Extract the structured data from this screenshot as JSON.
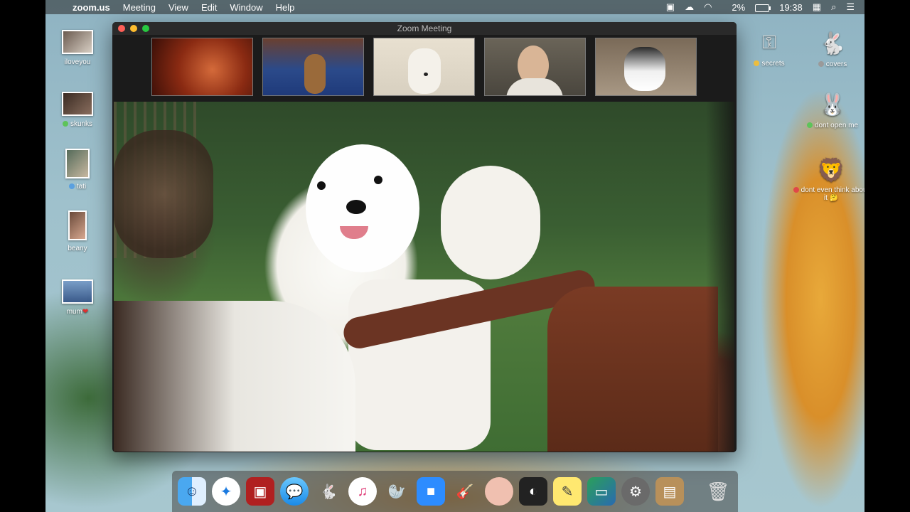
{
  "menubar": {
    "app": "zoom.us",
    "items": [
      "Meeting",
      "View",
      "Edit",
      "Window",
      "Help"
    ],
    "battery": "2%",
    "time": "19:38"
  },
  "window": {
    "title": "Zoom Meeting"
  },
  "desktop_left": [
    {
      "label": "iloveyou",
      "dot_color": ""
    },
    {
      "label": "skunks",
      "dot_color": "#5ec35a"
    },
    {
      "label": "tati",
      "dot_color": "#5aa0e0"
    },
    {
      "label": "beany",
      "dot_color": ""
    },
    {
      "label": "mum",
      "dot_color": ""
    }
  ],
  "desktop_right": [
    {
      "label": "secrets",
      "dot_color": "#f0c040"
    },
    {
      "label": "covers",
      "dot_color": "#9a9a9a"
    },
    {
      "label": "dont open me",
      "dot_color": "#5ec35a"
    },
    {
      "label": "dont even think about it",
      "dot_color": "#e04848"
    }
  ],
  "dock_icons": [
    "finder-icon",
    "safari-icon",
    "photo-booth-icon",
    "messages-icon",
    "bunny-app-icon",
    "music-icon",
    "seal-app-icon",
    "zoom-icon",
    "garageband-icon",
    "face-app-icon",
    "photo-app-icon",
    "stickies-icon",
    "preview-icon",
    "system-preferences-icon",
    "contacts-icon",
    "trash-icon"
  ]
}
